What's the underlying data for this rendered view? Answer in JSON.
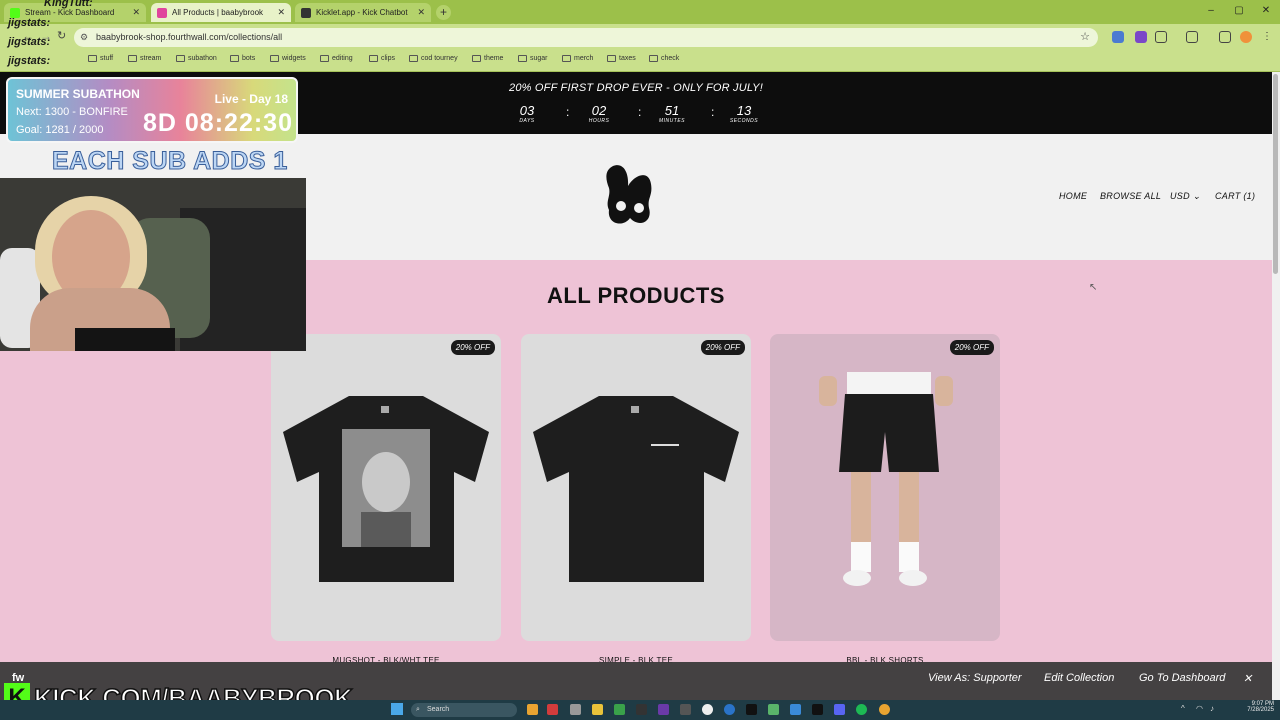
{
  "browser": {
    "tabs": [
      {
        "title": "Stream - Kick Dashboard",
        "color": "#53fc18"
      },
      {
        "title": "All Products | baabybrook",
        "color": "#e0459c"
      },
      {
        "title": "Kicklet.app - Kick Chatbot",
        "color": "#333333"
      }
    ],
    "url": "baabybrook-shop.fourthwall.com/collections/all",
    "bookmarks": [
      "stuff",
      "stream",
      "subathon",
      "bots",
      "widgets",
      "editing",
      "clips",
      "cod tourney",
      "theme",
      "sugar",
      "merch",
      "taxes",
      "check"
    ]
  },
  "site": {
    "promo": "20% OFF FIRST DROP EVER - ONLY FOR JULY!",
    "countdown": [
      {
        "value": "03",
        "label": "DAYS"
      },
      {
        "value": "02",
        "label": "HOURS"
      },
      {
        "value": "51",
        "label": "MINUTES"
      },
      {
        "value": "13",
        "label": "SECONDS"
      }
    ],
    "nav": {
      "home": "HOME",
      "browse": "BROWSE ALL",
      "currency": "USD",
      "cart": "CART (1)"
    },
    "title": "ALL PRODUCTS",
    "products": [
      {
        "name": "MUGSHOT - BLK/WHT TEE",
        "badge": "20% OFF"
      },
      {
        "name": "SIMPLE - BLK TEE",
        "badge": "20% OFF"
      },
      {
        "name": "BBL - BLK SHORTS",
        "badge": "20% OFF"
      }
    ],
    "admin_bar": {
      "view_as": "View As: Supporter",
      "edit": "Edit Collection",
      "dashboard": "Go To Dashboard"
    }
  },
  "overlay": {
    "subathon_title": "SUMMER SUBATHON",
    "live_day": "Live - Day 18",
    "next": "Next: 1300 - BONFIRE",
    "goal": "Goal: 1281 / 2000",
    "timer": "8D 08:22:30",
    "each_sub": "EACH SUB ADDS 1",
    "kick_url": "KICK.COM/BAABYBROOK",
    "chat": [
      "KingTutt:",
      "jigstats:",
      "jigstats:",
      "jigstats:"
    ]
  },
  "taskbar": {
    "search": "Search",
    "time": "9:07 PM",
    "date": "7/28/2025"
  }
}
